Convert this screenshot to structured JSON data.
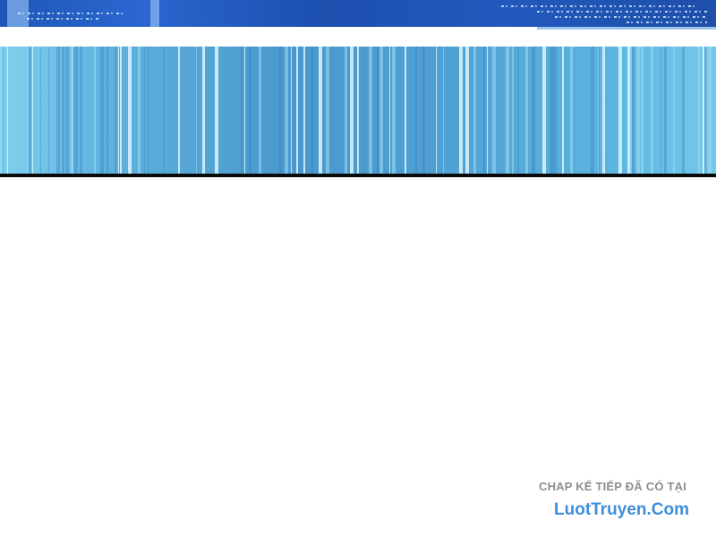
{
  "watermark": {
    "line1": "CHAP KẾ TIẾP ĐÃ CÓ TẠI",
    "line2": "LuotTruyen.Com"
  },
  "colors": {
    "top_band": "#1e57b8",
    "stripe_panel": "#4a98cd",
    "watermark_caption": "#8e8e8e",
    "watermark_site": "#3e8edb",
    "divider": "#0a0a0a"
  }
}
